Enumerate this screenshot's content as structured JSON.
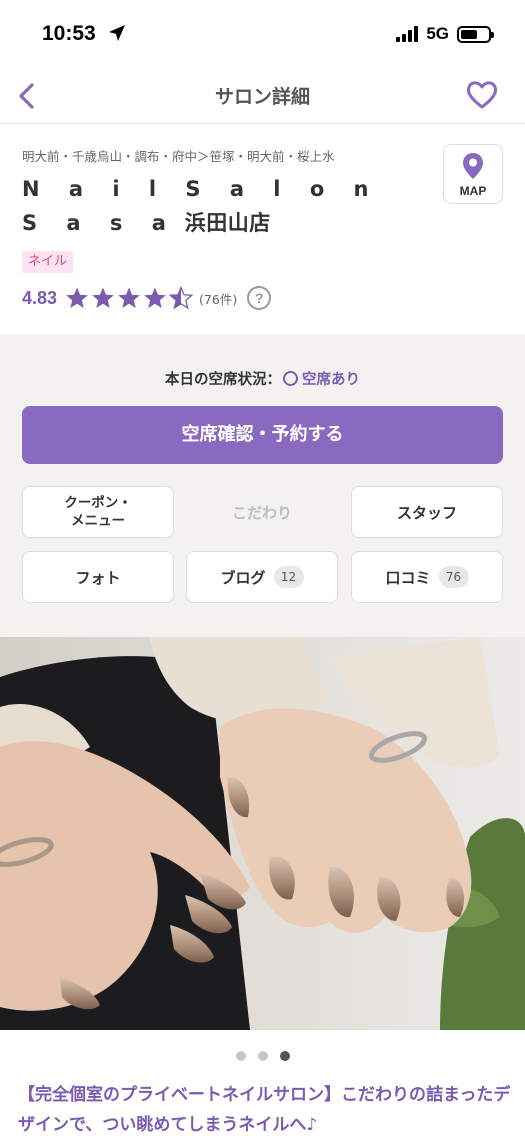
{
  "status_bar": {
    "time": "10:53",
    "network": "5G"
  },
  "header": {
    "title": "サロン詳細"
  },
  "salon": {
    "breadcrumb": "明大前・千歳烏山・調布・府中＞笹塚・明大前・桜上水",
    "name_part1": "N a i l   S a l o n   S a s a",
    "name_part2": " 浜田山店",
    "map_label": "MAP",
    "tag": "ネイル",
    "rating": {
      "value": "4.83",
      "score": 4.83,
      "max": 5,
      "count_text": "(76件)"
    },
    "help_symbol": "?"
  },
  "booking": {
    "availability_label": "本日の空席状況：",
    "availability_value": "空席あり",
    "reserve_button": "空席確認・予約する",
    "menu": {
      "coupon_line1": "クーポン・",
      "coupon_line2": "メニュー",
      "kodawari": "こだわり",
      "staff": "スタッフ",
      "photo": "フォト",
      "blog": "ブログ",
      "blog_count": "12",
      "reviews": "口コミ",
      "reviews_count": "76"
    }
  },
  "gallery": {
    "total": 3,
    "current": 3
  },
  "catchphrase": "【完全個室のプライベートネイルサロン】こだわりの詰まったデザインで、つい眺めてしまうネイルへ♪",
  "colors": {
    "accent": "#8a6ac0",
    "accent_text": "#7a5bb0",
    "tag_bg": "#fce3ef",
    "tag_text": "#d6478a"
  }
}
